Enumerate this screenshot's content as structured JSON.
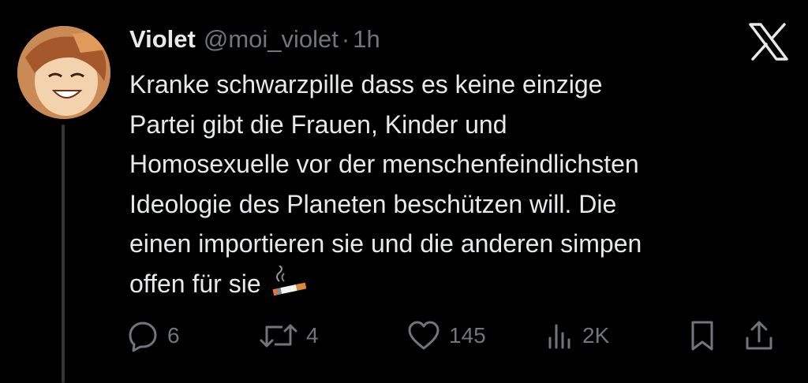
{
  "tweet": {
    "display_name": "Violet",
    "handle": "@moi_violet",
    "separator": "·",
    "time": "1h",
    "text": "Kranke schwarzpille dass es keine einzige\nPartei gibt die Frauen, Kinder und\nHomosexuelle vor der menschenfeindlichsten\nIdeologie des Planeten beschützen will. Die\neinen importieren sie und die anderen simpen\noffen für sie ",
    "emoji": "cigarette-emoji"
  },
  "actions": {
    "reply_count": "6",
    "retweet_count": "4",
    "like_count": "145",
    "views_count": "2K"
  },
  "icons": {
    "reply": "reply-icon",
    "retweet": "retweet-icon",
    "like": "heart-icon",
    "views": "views-icon",
    "bookmark": "bookmark-icon",
    "share": "share-icon",
    "logo": "x-logo-icon"
  },
  "colors": {
    "background": "#000000",
    "text": "#e7e9ea",
    "secondary": "#71767b",
    "thread_line": "#333639"
  }
}
